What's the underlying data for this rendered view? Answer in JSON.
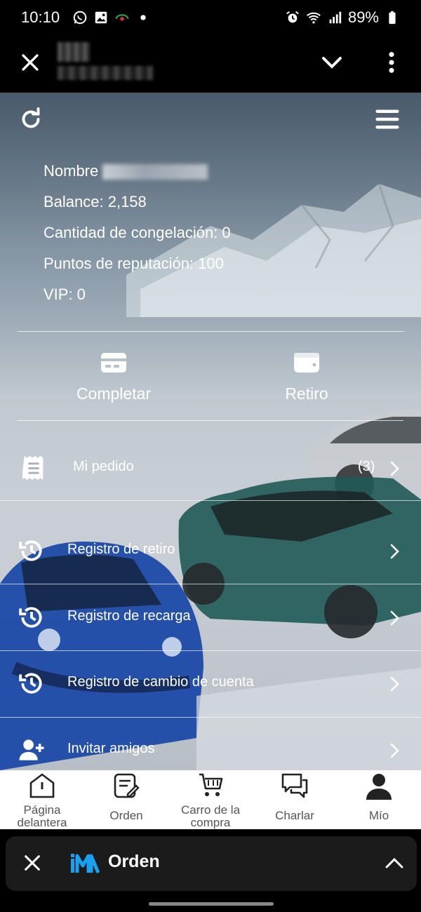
{
  "status_bar": {
    "time": "10:10",
    "battery": "89%",
    "left_icons": [
      "whatsapp-icon",
      "gallery-icon",
      "record-icon",
      "dot-icon"
    ],
    "right_icons": [
      "alarm-icon",
      "wifi-icon",
      "signal-icon",
      "battery-icon"
    ]
  },
  "top_bar": {
    "icons": [
      "close-icon",
      "chevron-down-icon",
      "more-vert-icon"
    ]
  },
  "header": {
    "icons": [
      "refresh-icon",
      "menu-icon"
    ]
  },
  "account": {
    "name_label": "Nombre",
    "balance": "Balance: 2,158",
    "freeze": "Cantidad de congelación: 0",
    "reputation": "Puntos de reputación: 100",
    "vip": "VIP: 0"
  },
  "actions": [
    {
      "label": "Completar",
      "icon": "card-icon"
    },
    {
      "label": "Retiro",
      "icon": "wallet-icon"
    }
  ],
  "menu": {
    "my_order": {
      "label": "Mi pedido",
      "count": "(3)",
      "icon": "receipt-icon"
    },
    "items": [
      {
        "label": "Registro de retiro",
        "icon": "history-icon"
      },
      {
        "label": "Registro de recarga",
        "icon": "history-icon"
      },
      {
        "label": "Registro de cambio de cuenta",
        "icon": "history-icon"
      },
      {
        "label": "Invitar amigos",
        "icon": "add-user-icon"
      }
    ]
  },
  "bottom_nav": [
    {
      "label": "Página delantera",
      "icon": "home-icon"
    },
    {
      "label": "Orden",
      "icon": "order-edit-icon"
    },
    {
      "label": "Carro de la compra",
      "icon": "cart-icon"
    },
    {
      "label": "Charlar",
      "icon": "chat-icon"
    },
    {
      "label": "Mío",
      "icon": "user-icon"
    }
  ],
  "floating_chat": {
    "title": "Orden",
    "icons": [
      "close-icon",
      "im-logo-icon",
      "chevron-up-icon"
    ]
  }
}
